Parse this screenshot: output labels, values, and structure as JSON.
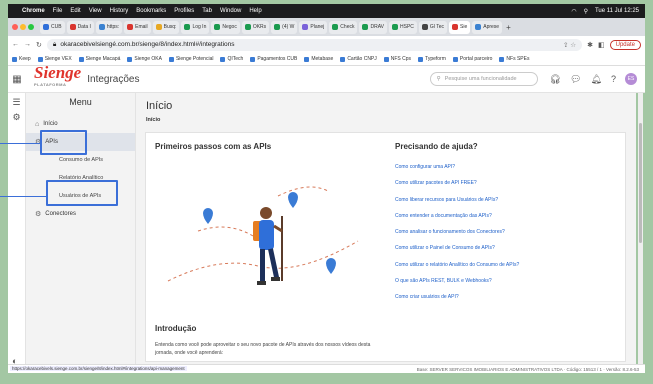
{
  "mac": {
    "apple": "",
    "app": "Chrome",
    "menus": [
      "File",
      "Edit",
      "View",
      "History",
      "Bookmarks",
      "Profiles",
      "Tab",
      "Window",
      "Help"
    ],
    "clock": "Tue 11 Jul 12:25"
  },
  "tabs": [
    {
      "label": "CUB",
      "color": "#2f6fd9"
    },
    {
      "label": "Data I",
      "color": "#d9352f"
    },
    {
      "label": "https:",
      "color": "#3b82d1"
    },
    {
      "label": "Email",
      "color": "#d9352f"
    },
    {
      "label": "Busq:",
      "color": "#e7a823"
    },
    {
      "label": "Log In",
      "color": "#1b9b4f"
    },
    {
      "label": "Negoc",
      "color": "#1b9b4f"
    },
    {
      "label": "OKRs",
      "color": "#1b9b4f"
    },
    {
      "label": "(4) W",
      "color": "#1b9b4f"
    },
    {
      "label": "Planej",
      "color": "#7a62d9"
    },
    {
      "label": "Check",
      "color": "#1b9b4f"
    },
    {
      "label": "DRAV",
      "color": "#1b9b4f"
    },
    {
      "label": "HSPC",
      "color": "#1b9b4f"
    },
    {
      "label": "Gl Tec",
      "color": "#444"
    },
    {
      "label": "Sie",
      "color": "#d9352f"
    },
    {
      "label": "Aprese",
      "color": "#3b82d1"
    }
  ],
  "url": {
    "text": "okaracebivelsiengé.com.br/sienge/8/index.html#/integrations",
    "update": "Update"
  },
  "bookmarks": [
    "Keep",
    "Sienge VEX",
    "Sienge Macapá",
    "Sienge OKA",
    "Sienge Potencial",
    "QITech",
    "Pagamentos CUB",
    "Metabase",
    "Cartão CNPJ",
    "NFS Cps",
    "Typeform",
    "Portal parceiro",
    "NFs SPEs"
  ],
  "app": {
    "logo": "Sienge",
    "logo_sub": "PLATAFORMA",
    "title": "Integrações",
    "search_placeholder": "Pesquise uma funcionalidade",
    "avatar": "ES"
  },
  "menu": {
    "title": "Menu",
    "items": [
      {
        "label": "Início",
        "icon": "⌂"
      },
      {
        "label": "APIs",
        "icon": "⚙"
      },
      {
        "label": "Consumo de APIs"
      },
      {
        "label": "Relatório Analítico"
      },
      {
        "label": "Usuários de APIs"
      },
      {
        "label": "Conectores",
        "icon": "⚙"
      }
    ]
  },
  "main": {
    "title": "Início",
    "breadcrumb": "Início",
    "first_steps": "Primeiros passos com as APIs",
    "help_title": "Precisando de ajuda?",
    "help_links": [
      "Como configurar uma API?",
      "Como utilizar pacotes de API FREE?",
      "Como liberar recursos para Usuários de APIs?",
      "Como entender a documentação das APIs?",
      "Como analisar o funcionamento dos Conectores?",
      "Como utilizar o Painel de Consumo de APIs?",
      "Como utilizar o relatório Analítico do Consumo de APIs?",
      "O que são APIs REST, BULK e Webhooks?",
      "Como criar usuários de API?"
    ],
    "intro_title": "Introdução",
    "intro_text": "Entenda como você pode aproveitar o seu novo pacote de APIs através dos nossos vídeos desta jornada, onde você aprenderá:"
  },
  "status": {
    "url": "https://okaracebivels.sienge.com.br/sienge/8/index.html#/integrations/api-management",
    "footer": "Base: SERVER SERVICOS IMOBILIARIOS E ADMINISTRATIVOS LTDA · Código: 15513 / 1 · Versão: 8.2.6-53"
  },
  "colors": {
    "accent": "#3b6fd8",
    "brand": "#e0332c",
    "link": "#1d5fc9",
    "background": "#a3c7a3"
  }
}
